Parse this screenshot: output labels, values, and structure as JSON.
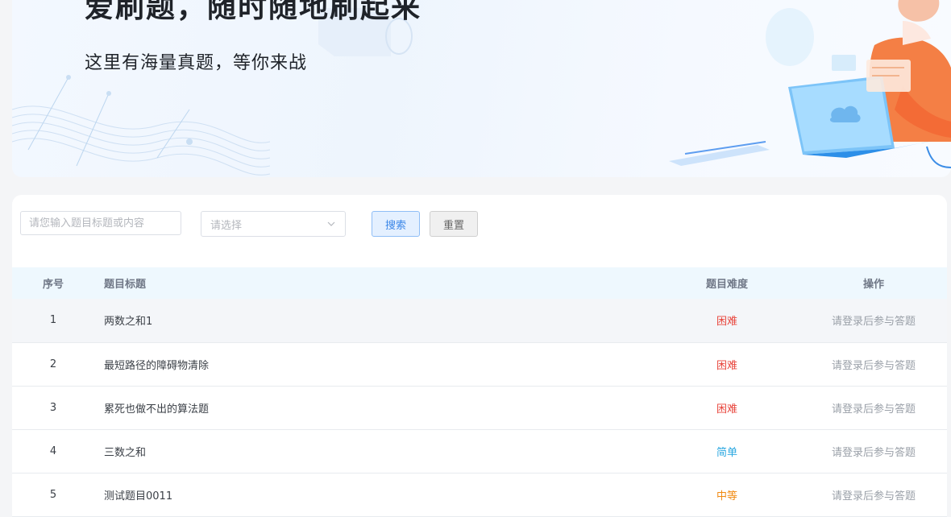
{
  "banner": {
    "title": "爱刷题，随时随地刷起来",
    "subtitle": "这里有海量真题，等你来战"
  },
  "search": {
    "placeholder": "请您输入题目标题或内容",
    "select_placeholder": "请选择",
    "search_label": "搜索",
    "reset_label": "重置"
  },
  "table": {
    "headers": {
      "index": "序号",
      "title": "题目标题",
      "difficulty": "题目难度",
      "action": "操作"
    },
    "rows": [
      {
        "index": "1",
        "title": "两数之和1",
        "difficulty": "困难",
        "action": "请登录后参与答题"
      },
      {
        "index": "2",
        "title": "最短路径的障碍物清除",
        "difficulty": "困难",
        "action": "请登录后参与答题"
      },
      {
        "index": "3",
        "title": "累死也做不出的算法题",
        "difficulty": "困难",
        "action": "请登录后参与答题"
      },
      {
        "index": "4",
        "title": "三数之和",
        "difficulty": "简单",
        "action": "请登录后参与答题"
      },
      {
        "index": "5",
        "title": "测试题目0011",
        "difficulty": "中等",
        "action": "请登录后参与答题"
      }
    ]
  },
  "colors": {
    "hard": "#e8453c",
    "easy": "#2aa7e0",
    "medium": "#f08a12",
    "accent": "#3a86e8"
  },
  "icons": {
    "select_arrow": "chevron-down-icon",
    "illustration": "person-laptop-illustration"
  }
}
